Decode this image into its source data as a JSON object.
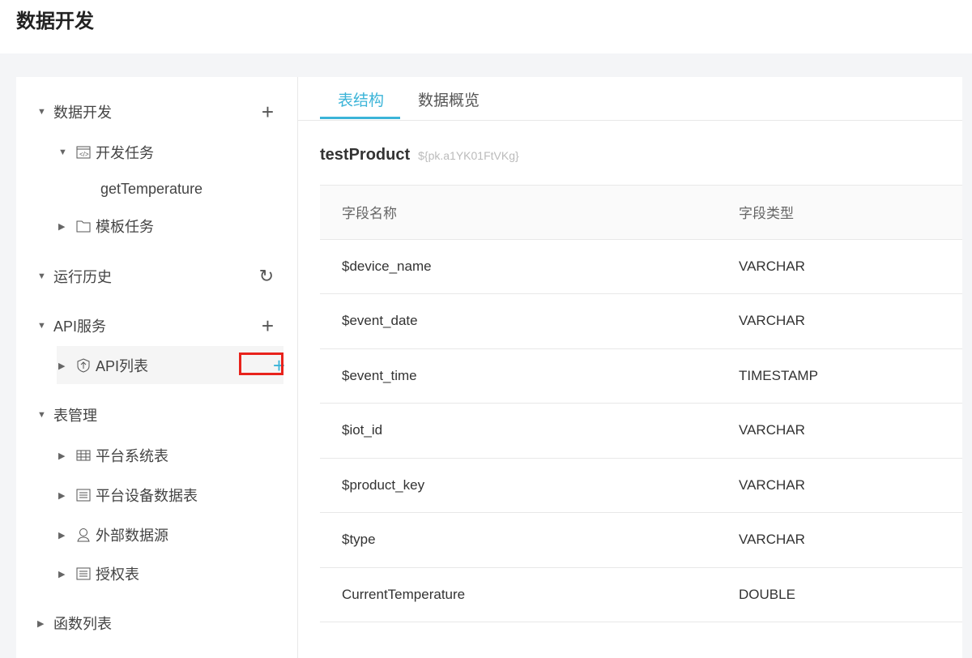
{
  "page_title": "数据开发",
  "sidebar": {
    "items": [
      {
        "label": "数据开发",
        "action": "plus-icon"
      },
      {
        "label": "开发任务",
        "icon": "code-file-icon"
      },
      {
        "label": "getTemperature"
      },
      {
        "label": "模板任务",
        "icon": "folder-icon"
      },
      {
        "label": "运行历史",
        "action": "refresh-icon"
      },
      {
        "label": "API服务",
        "action": "plus-icon"
      },
      {
        "label": "API列表",
        "icon": "api-shield-icon",
        "action": "plus-icon"
      },
      {
        "label": "表管理"
      },
      {
        "label": "平台系统表",
        "icon": "table-grid-icon"
      },
      {
        "label": "平台设备数据表",
        "icon": "list-table-icon"
      },
      {
        "label": "外部数据源",
        "icon": "user-source-icon"
      },
      {
        "label": "授权表",
        "icon": "list-table-icon"
      },
      {
        "label": "函数列表"
      }
    ]
  },
  "tabs": [
    {
      "label": "表结构",
      "active": true
    },
    {
      "label": "数据概览"
    }
  ],
  "accent": "#3bb4d8",
  "table_name": "testProduct",
  "table_key": "${pk.a1YK01FtVKg}",
  "columns": [
    "字段名称",
    "字段类型"
  ],
  "rows": [
    [
      "$device_name",
      "VARCHAR"
    ],
    [
      "$event_date",
      "VARCHAR"
    ],
    [
      "$event_time",
      "TIMESTAMP"
    ],
    [
      "$iot_id",
      "VARCHAR"
    ],
    [
      "$product_key",
      "VARCHAR"
    ],
    [
      "$type",
      "VARCHAR"
    ],
    [
      "CurrentTemperature",
      "DOUBLE"
    ]
  ]
}
